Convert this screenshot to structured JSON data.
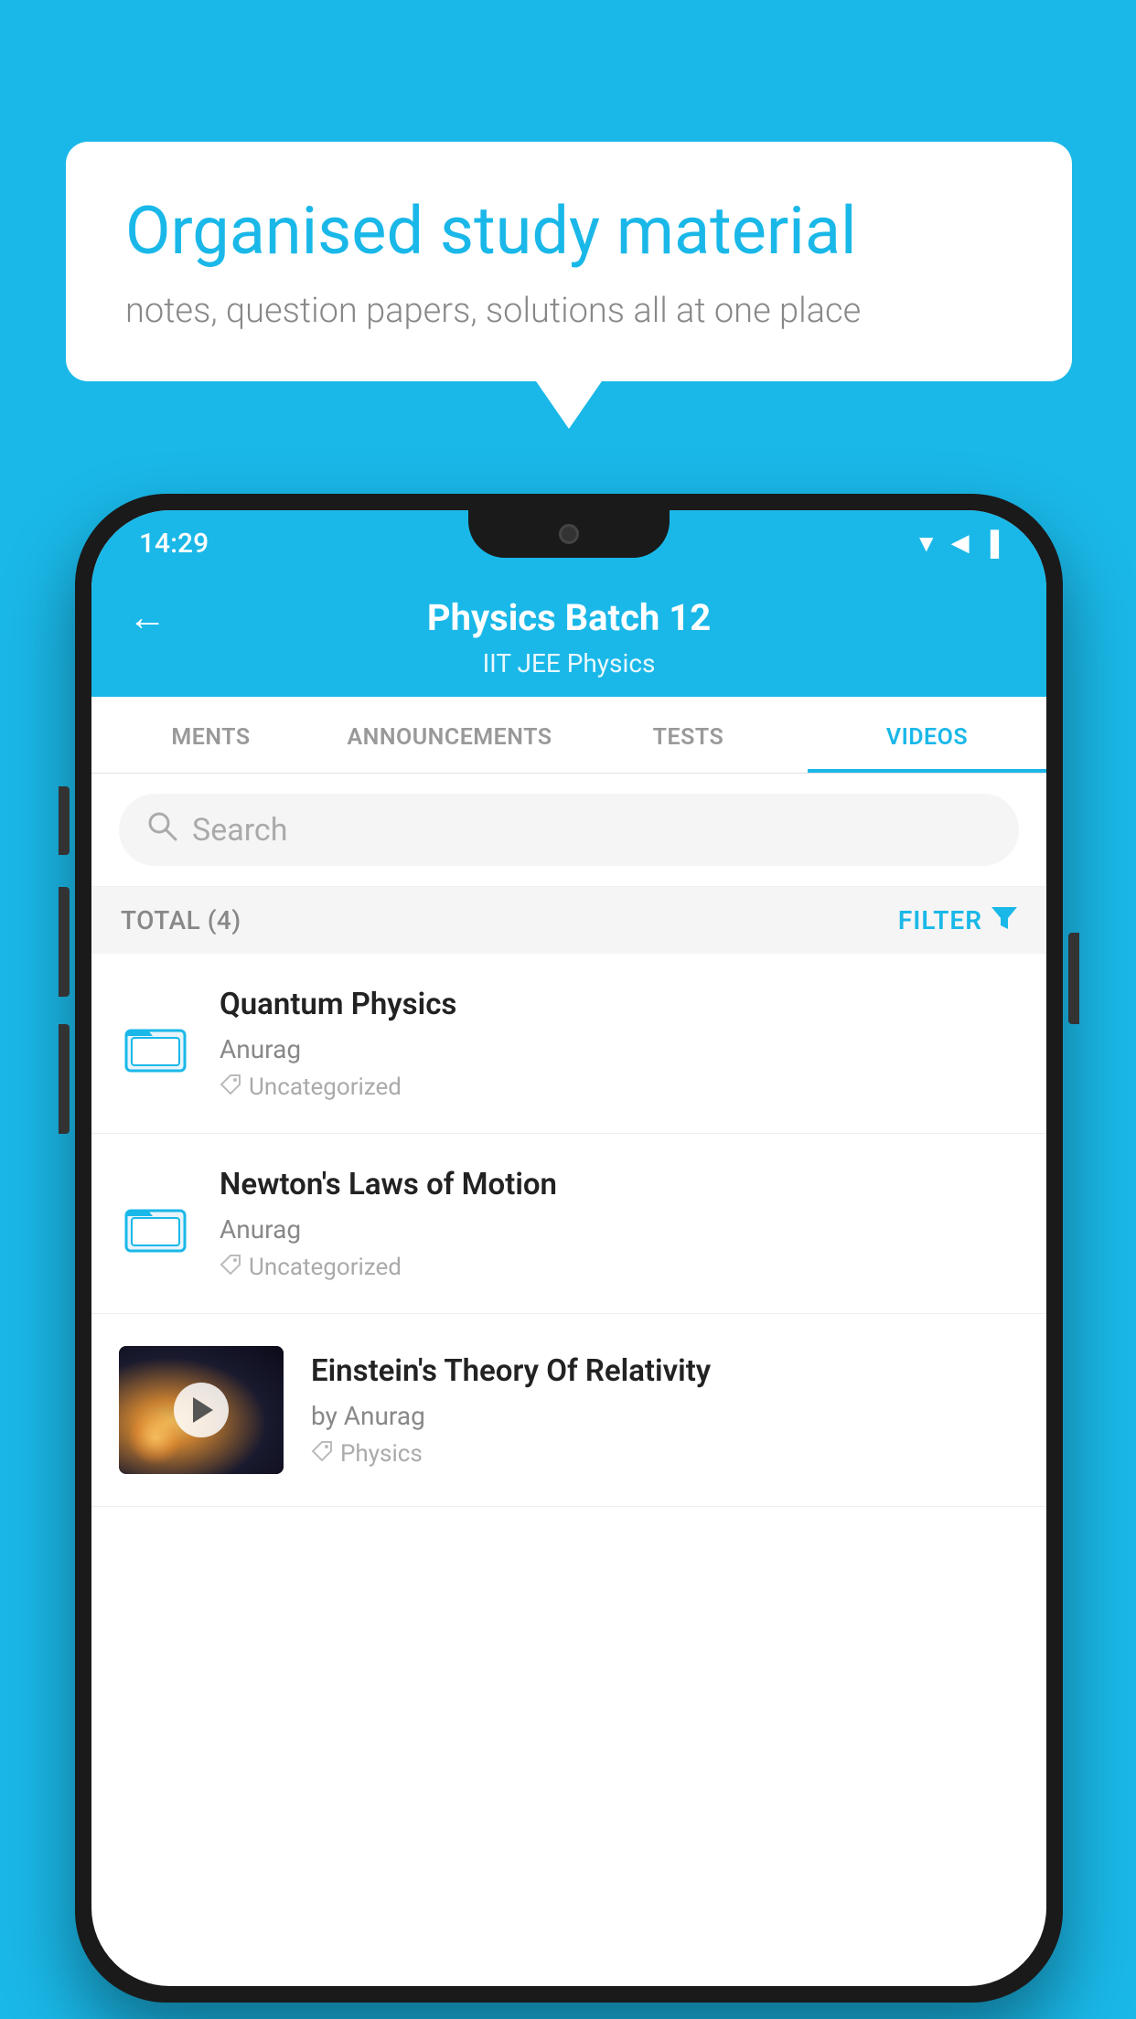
{
  "background_color": "#1ab8e8",
  "bubble": {
    "title": "Organised study material",
    "subtitle": "notes, question papers, solutions all at one place"
  },
  "status_bar": {
    "time": "14:29",
    "icons": [
      "wifi",
      "signal",
      "battery"
    ]
  },
  "header": {
    "title": "Physics Batch 12",
    "subtitle": "IIT JEE   Physics",
    "back_label": "←"
  },
  "tabs": [
    {
      "label": "MENTS",
      "active": false
    },
    {
      "label": "ANNOUNCEMENTS",
      "active": false
    },
    {
      "label": "TESTS",
      "active": false
    },
    {
      "label": "VIDEOS",
      "active": true
    }
  ],
  "search": {
    "placeholder": "Search"
  },
  "filter_row": {
    "total_label": "TOTAL (4)",
    "filter_label": "FILTER",
    "filter_icon": "▼"
  },
  "videos": [
    {
      "id": 1,
      "title": "Quantum Physics",
      "author": "Anurag",
      "tag": "Uncategorized",
      "has_thumb": false
    },
    {
      "id": 2,
      "title": "Newton's Laws of Motion",
      "author": "Anurag",
      "tag": "Uncategorized",
      "has_thumb": false
    },
    {
      "id": 3,
      "title": "Einstein's Theory Of Relativity",
      "author": "by Anurag",
      "tag": "Physics",
      "has_thumb": true
    }
  ]
}
